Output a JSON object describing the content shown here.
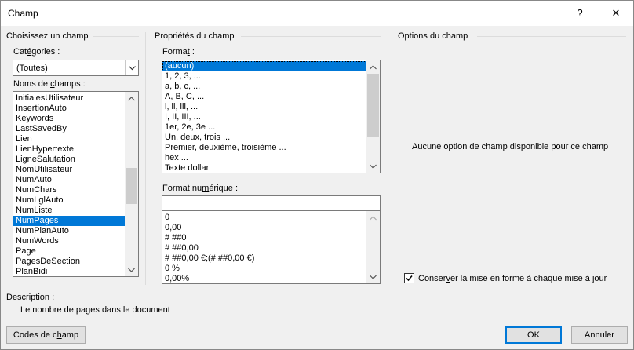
{
  "window": {
    "title": "Champ",
    "help_label": "?",
    "close_label": "✕"
  },
  "left": {
    "group_title": "Choisissez un champ",
    "categories_label_pre": "Cat",
    "categories_label_u": "é",
    "categories_label_post": "gories :",
    "categories_value": "(Toutes)",
    "fieldnames_label_pre": "Noms de ",
    "fieldnames_label_u": "c",
    "fieldnames_label_post": "hamps :",
    "fields": [
      "InitialesUtilisateur",
      "InsertionAuto",
      "Keywords",
      "LastSavedBy",
      "Lien",
      "LienHypertexte",
      "LigneSalutation",
      "NomUtilisateur",
      "NumAuto",
      "NumChars",
      "NumLglAuto",
      "NumListe",
      "NumPages",
      "NumPlanAuto",
      "NumWords",
      "Page",
      "PagesDeSection",
      "PlanBidi"
    ],
    "selected_field": "NumPages"
  },
  "middle": {
    "group_title": "Propriétés du champ",
    "format_label_pre": "Forma",
    "format_label_u": "t",
    "format_label_post": " :",
    "formats": [
      "(aucun)",
      "1, 2, 3, ...",
      "a, b, c, ...",
      "A, B, C, ...",
      "i, ii, iii, ...",
      "I, II, III, ...",
      "1er, 2e, 3e ...",
      "Un, deux, trois ...",
      "Premier, deuxième, troisième ...",
      "hex ...",
      "Texte dollar"
    ],
    "selected_format": "(aucun)",
    "numformat_label_pre": "Format nu",
    "numformat_label_u": "m",
    "numformat_label_post": "érique :",
    "numformat_value": "",
    "numformats": [
      "0",
      "0,00",
      "# ##0",
      "# ##0,00",
      "# ##0,00 €;(# ##0,00 €)",
      "0 %",
      "0,00%"
    ]
  },
  "right": {
    "group_title": "Options du champ",
    "no_options_text": "Aucune option de champ disponible pour ce champ",
    "preserve_pre": "Conser",
    "preserve_u": "v",
    "preserve_post": "er la mise en forme à chaque mise à jour",
    "preserve_checked": true
  },
  "description": {
    "label": "Description :",
    "text": "Le nombre de pages dans le document"
  },
  "buttons": {
    "codes_pre": "Codes de c",
    "codes_u": "h",
    "codes_post": "amp",
    "ok": "OK",
    "cancel": "Annuler"
  }
}
